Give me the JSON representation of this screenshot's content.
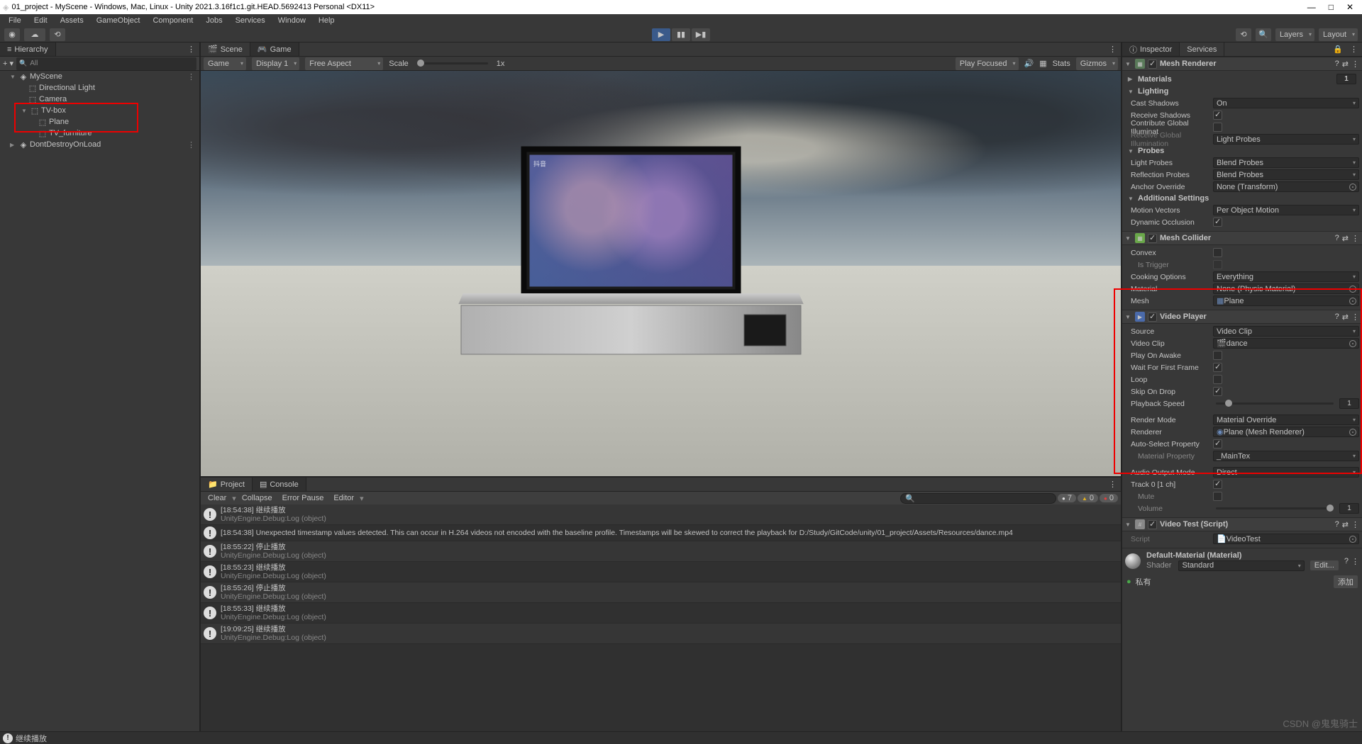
{
  "window": {
    "title": "01_project - MyScene - Windows, Mac, Linux - Unity 2021.3.16f1c1.git.HEAD.5692413 Personal <DX11>"
  },
  "menu": [
    "File",
    "Edit",
    "Assets",
    "GameObject",
    "Component",
    "Jobs",
    "Services",
    "Window",
    "Help"
  ],
  "topright": {
    "layers": "Layers",
    "layout": "Layout"
  },
  "hierarchy": {
    "tab": "Hierarchy",
    "search_placeholder": "All",
    "items": [
      {
        "name": "MyScene",
        "indent": 22,
        "fold": "▼",
        "icon": "unity"
      },
      {
        "name": "Directional Light",
        "indent": 44,
        "icon": "cube"
      },
      {
        "name": "Camera",
        "indent": 44,
        "icon": "cube"
      },
      {
        "name": "TV-box",
        "indent": 36,
        "fold": "▼",
        "icon": "cube"
      },
      {
        "name": "Plane",
        "indent": 56,
        "icon": "cube"
      },
      {
        "name": "TV_furniture",
        "indent": 56,
        "icon": "cube"
      },
      {
        "name": "DontDestroyOnLoad",
        "indent": 22,
        "fold": "▶",
        "icon": "unity"
      }
    ]
  },
  "scene": {
    "tabs": [
      "Scene",
      "Game"
    ],
    "toolbar": {
      "display": "Game",
      "display_num": "Display 1",
      "aspect": "Free Aspect",
      "scale": "Scale",
      "scale_val": "1x",
      "focus": "Play Focused",
      "stats": "Stats",
      "gizmos": "Gizmos"
    },
    "watermark": "抖音"
  },
  "project": {
    "tabs": [
      "Project",
      "Console"
    ]
  },
  "console": {
    "btns": {
      "clear": "Clear",
      "collapse": "Collapse",
      "errpause": "Error Pause",
      "editor": "Editor"
    },
    "counts": {
      "info": "7",
      "warn": "0",
      "err": "0"
    },
    "logs": [
      {
        "t": "[18:54:38] 继续播放",
        "s": "UnityEngine.Debug:Log (object)"
      },
      {
        "t": "[18:54:38] Unexpected timestamp values detected. This can occur in H.264 videos not encoded with the baseline profile. Timestamps will be skewed to correct the playback for D:/Study/GitCode/unity/01_project/Assets/Resources/dance.mp4",
        "s": ""
      },
      {
        "t": "[18:55:22] 停止播放",
        "s": "UnityEngine.Debug:Log (object)"
      },
      {
        "t": "[18:55:23] 继续播放",
        "s": "UnityEngine.Debug:Log (object)"
      },
      {
        "t": "[18:55:26] 停止播放",
        "s": "UnityEngine.Debug:Log (object)"
      },
      {
        "t": "[18:55:33] 继续播放",
        "s": "UnityEngine.Debug:Log (object)"
      },
      {
        "t": "[19:09:25] 继续播放",
        "s": "UnityEngine.Debug:Log (object)"
      }
    ]
  },
  "inspector": {
    "tab": "Inspector",
    "services": "Services",
    "mesh_renderer": {
      "title": "Mesh Renderer",
      "materials": "Materials",
      "mat_count": "1",
      "lighting": "Lighting",
      "cast": "Cast Shadows",
      "cast_v": "On",
      "recv": "Receive Shadows",
      "contrib": "Contribute Global Illuminat",
      "recv_gi": "Receive Global Illumination",
      "recv_gi_v": "Light Probes",
      "probes": "Probes",
      "lp": "Light Probes",
      "lp_v": "Blend Probes",
      "rp": "Reflection Probes",
      "rp_v": "Blend Probes",
      "ao": "Anchor Override",
      "ao_v": "None (Transform)",
      "add": "Additional Settings",
      "mv": "Motion Vectors",
      "mv_v": "Per Object Motion",
      "dyn": "Dynamic Occlusion"
    },
    "mesh_collider": {
      "title": "Mesh Collider",
      "convex": "Convex",
      "trigger": "Is Trigger",
      "cook": "Cooking Options",
      "cook_v": "Everything",
      "mat": "Material",
      "mat_v": "None (Physic Material)",
      "mesh": "Mesh",
      "mesh_v": "Plane"
    },
    "video_player": {
      "title": "Video Player",
      "source": "Source",
      "source_v": "Video Clip",
      "clip": "Video Clip",
      "clip_v": "dance",
      "awake": "Play On Awake",
      "wait": "Wait For First Frame",
      "loop": "Loop",
      "skip": "Skip On Drop",
      "speed": "Playback Speed",
      "speed_v": "1",
      "rmode": "Render Mode",
      "rmode_v": "Material Override",
      "renderer": "Renderer",
      "renderer_v": "Plane (Mesh Renderer)",
      "auto": "Auto-Select Property",
      "matprop": "Material Property",
      "matprop_v": "_MainTex",
      "audio": "Audio Output Mode",
      "audio_v": "Direct",
      "track": "Track 0 [1 ch]",
      "mute": "Mute",
      "vol": "Volume",
      "vol_v": "1"
    },
    "video_test": {
      "title": "Video Test (Script)",
      "script": "Script",
      "script_v": "VideoTest"
    },
    "material": {
      "name": "Default-Material (Material)",
      "shader": "Shader",
      "shader_v": "Standard",
      "edit": "Edit..."
    },
    "private": "私有",
    "add": "添加"
  },
  "status": "继续播放",
  "watermark_br": "CSDN @鬼鬼骑士"
}
